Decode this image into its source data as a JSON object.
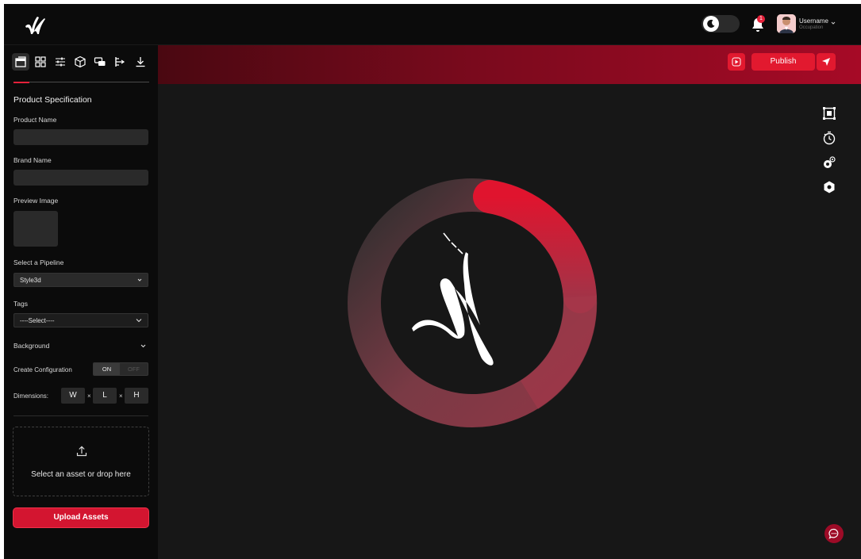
{
  "header": {
    "user_name": "Username",
    "user_occupation": "Occupation",
    "notification_count": "1",
    "theme_mode": "dark"
  },
  "sidebar": {
    "tools": [
      "layers-icon",
      "grid-icon",
      "sliders-icon",
      "cube-icon",
      "chat-icon",
      "flow-icon",
      "download-icon"
    ],
    "section_title": "Product Specification",
    "product_name_label": "Product Name",
    "product_name_value": "",
    "brand_name_label": "Brand Name",
    "brand_name_value": "",
    "preview_image_label": "Preview Image",
    "pipeline_label": "Select a Pipeline",
    "pipeline_value": "Style3d",
    "tags_label": "Tags",
    "tags_value": "----Select----",
    "background_label": "Background",
    "create_config_label": "Create Configuration",
    "toggle_on": "ON",
    "toggle_off": "OFF",
    "dimensions_label": "Dimensions:",
    "dim_w": "W",
    "dim_l": "L",
    "dim_h": "H",
    "dim_sep": "×",
    "drop_text": "Select an asset or drop here",
    "upload_button": "Upload Assets"
  },
  "toolbar": {
    "publish_label": "Publish"
  },
  "canvas": {
    "right_tools": [
      "frame-icon",
      "timer-icon",
      "settings-icon",
      "hexagon-icon"
    ]
  },
  "colors": {
    "accent": "#e2192f",
    "background": "#0a0a0a",
    "canvas": "#171717",
    "field": "#2a2a2a"
  }
}
